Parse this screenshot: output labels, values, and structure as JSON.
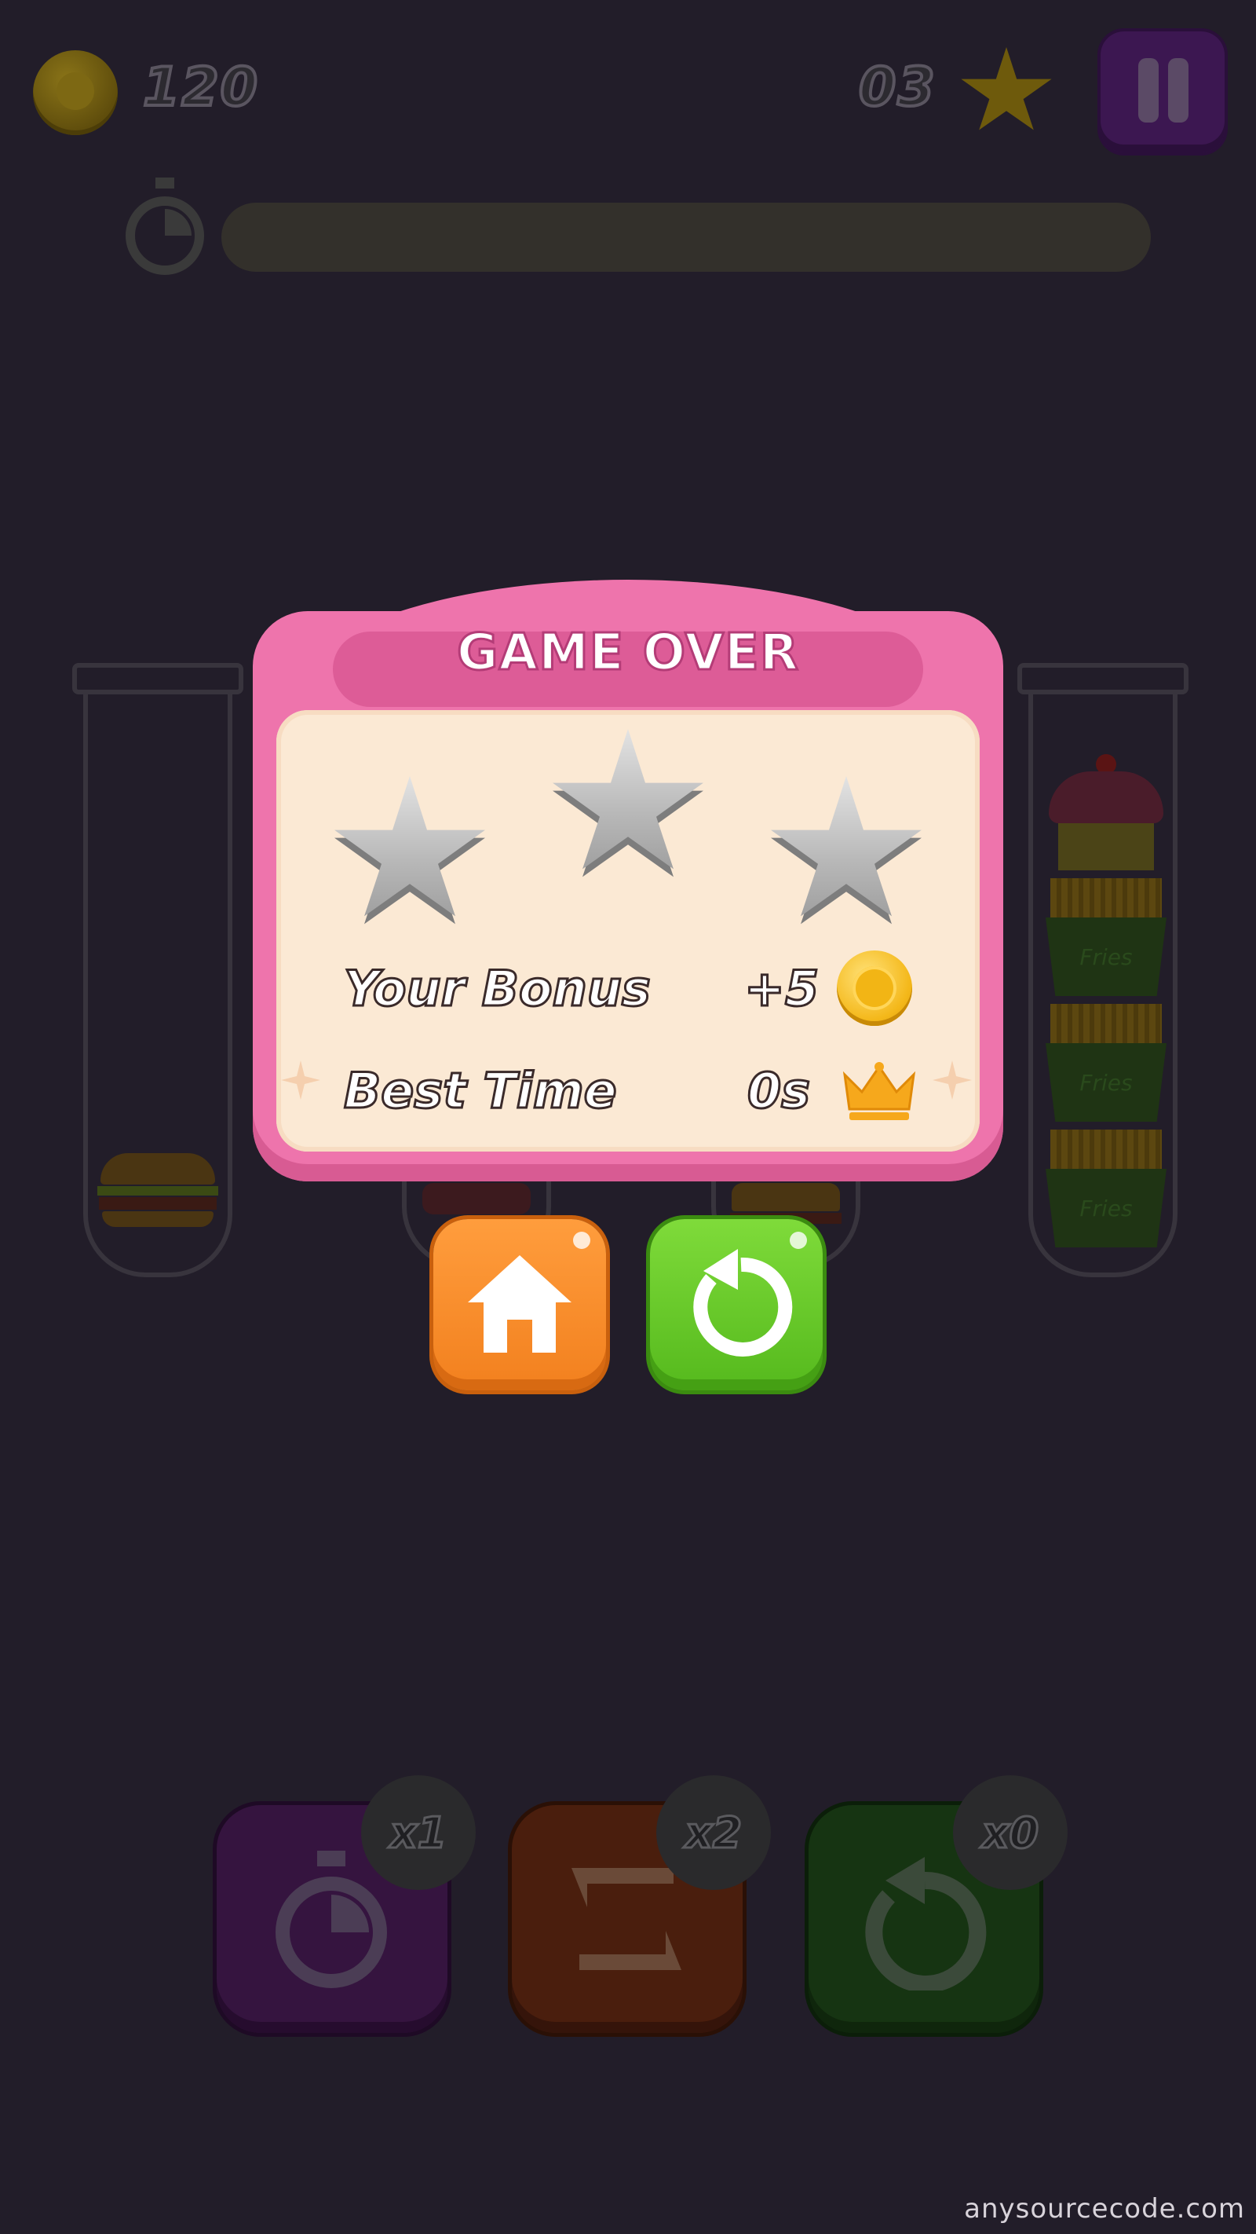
{
  "hud": {
    "coins": "120",
    "stars": "03",
    "icons": {
      "coin": "coin-icon",
      "star": "star-icon",
      "pause": "pause-icon",
      "timer": "stopwatch-icon"
    }
  },
  "dialog": {
    "title": "GAME OVER",
    "stars_earned": 0,
    "stars_total": 3,
    "bonus_label": "Your Bonus",
    "bonus_value": "+5",
    "best_time_label": "Best Time",
    "best_time_value": "0s"
  },
  "actions": {
    "home_icon": "home-icon",
    "replay_icon": "replay-icon"
  },
  "boosters": [
    {
      "icon": "stopwatch-icon",
      "count": "x1",
      "color": "#35143f"
    },
    {
      "icon": "swap-icon",
      "count": "x2",
      "color": "#4a1e0d"
    },
    {
      "icon": "undo-icon",
      "count": "x0",
      "color": "#163412"
    }
  ],
  "tubes": {
    "right_labels": [
      "Fries",
      "Fries",
      "Fries"
    ]
  },
  "watermark": "anysourcecode.com",
  "colors": {
    "dialog_frame": "#ee74ac",
    "dialog_panel": "#fbe9d4",
    "home_button": "#f2801e",
    "replay_button": "#55b91d",
    "background": "#221d29"
  }
}
